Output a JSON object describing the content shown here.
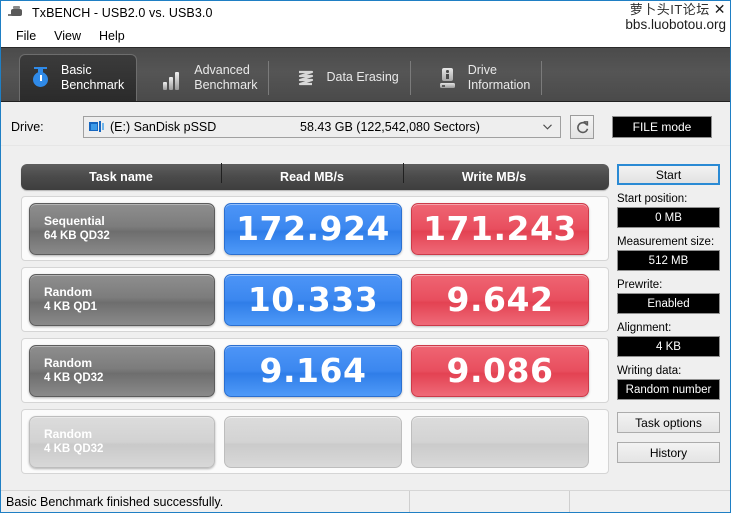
{
  "window": {
    "title": "TxBENCH - USB2.0 vs. USB3.0",
    "app_icon": "usb-plug-icon"
  },
  "watermark": {
    "line1": "萝卜头IT论坛",
    "close": "✕",
    "line2": "bbs.luobotou.org"
  },
  "menu": {
    "items": [
      {
        "label": "File"
      },
      {
        "label": "View"
      },
      {
        "label": "Help"
      }
    ]
  },
  "tabs": [
    {
      "label": "Basic\nBenchmark",
      "icon": "stopwatch-icon",
      "active": true
    },
    {
      "label": "Advanced\nBenchmark",
      "icon": "bar-chart-icon",
      "active": false
    },
    {
      "label": "Data Erasing",
      "icon": "shred-icon",
      "active": false
    },
    {
      "label": "Drive\nInformation",
      "icon": "drive-info-icon",
      "active": false
    }
  ],
  "drive": {
    "label": "Drive:",
    "icon": "drive-icon",
    "name": "(E:) SanDisk pSSD",
    "size": "58.43 GB (122,542,080 Sectors)",
    "chevron": "chevron-down-icon",
    "refresh_icon": "refresh-icon",
    "mode_button": "FILE mode"
  },
  "table": {
    "headers": [
      "Task name",
      "Read MB/s",
      "Write MB/s"
    ],
    "rows": [
      {
        "task_line1": "Sequential",
        "task_line2": "64 KB QD32",
        "read": "172.924",
        "write": "171.243",
        "enabled": true
      },
      {
        "task_line1": "Random",
        "task_line2": "4 KB QD1",
        "read": "10.333",
        "write": "9.642",
        "enabled": true
      },
      {
        "task_line1": "Random",
        "task_line2": "4 KB QD32",
        "read": "9.164",
        "write": "9.086",
        "enabled": true
      },
      {
        "task_line1": "Random",
        "task_line2": "4 KB QD32",
        "read": "",
        "write": "",
        "enabled": false
      }
    ]
  },
  "side": {
    "start_button": "Start",
    "start_position_label": "Start position:",
    "start_position_value": "0 MB",
    "measurement_size_label": "Measurement size:",
    "measurement_size_value": "512 MB",
    "prewrite_label": "Prewrite:",
    "prewrite_value": "Enabled",
    "alignment_label": "Alignment:",
    "alignment_value": "4 KB",
    "writing_data_label": "Writing data:",
    "writing_data_value": "Random number",
    "task_options_button": "Task options",
    "history_button": "History"
  },
  "status": {
    "message": "Basic Benchmark finished successfully."
  },
  "colors": {
    "read_blue": "#3b87ef",
    "write_red": "#e84e5e",
    "tab_dark": "#4e4e4e",
    "accent_border": "#1f7fc4"
  },
  "chart_data": {
    "type": "bar",
    "title": "Basic Benchmark results",
    "categories": [
      "Sequential 64 KB QD32",
      "Random 4 KB QD1",
      "Random 4 KB QD32",
      "Random 4 KB QD32"
    ],
    "series": [
      {
        "name": "Read MB/s",
        "values": [
          172.924,
          10.333,
          9.164,
          null
        ]
      },
      {
        "name": "Write MB/s",
        "values": [
          171.243,
          9.642,
          9.086,
          null
        ]
      }
    ],
    "xlabel": "Task name",
    "ylabel": "MB/s",
    "legend": [
      "Read MB/s",
      "Write MB/s"
    ]
  }
}
